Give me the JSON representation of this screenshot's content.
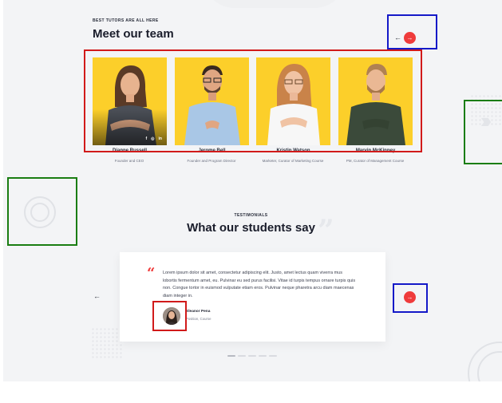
{
  "team": {
    "eyebrow": "BEST TUTORS ARE ALL HERE",
    "title": "Meet our team",
    "prev": "←",
    "next": "→",
    "members": [
      {
        "name": "Dianne Russell",
        "role": "Founder and CEO"
      },
      {
        "name": "Jerome Bell",
        "role": "Founder and Program Director"
      },
      {
        "name": "Kristin Watson",
        "role": "Marketer, Curator of Marketing Course"
      },
      {
        "name": "Marvin McKinney",
        "role": "PM, Curator of Management Course"
      }
    ],
    "socials": [
      "f",
      "◎",
      "in"
    ]
  },
  "testimonials": {
    "eyebrow": "TESTIMONIALS",
    "title": "What our students say",
    "quote_mark": "“",
    "quote": "Lorem ipsum dolor sit amet, consectetur adipiscing elit. Justo, amet lectus quam viverra mus lobortis fermentum amet, eu. Pulvinar eu sed purus facilisi. Vitae id turpis tempus ornare turpis quis non. Congue tortor in euismod vulputate etiam eros. Pulvinar neque pharetra arcu diam maecenas diam integer in.",
    "author_name": "Eleanor Pena",
    "author_role": "Position, Course",
    "prev": "←",
    "next": "→",
    "dots": 5,
    "active_dot": 0
  },
  "colors": {
    "accent": "#ef3b3b",
    "card_yellow": "#fccf2a",
    "background": "#f3f4f6"
  }
}
